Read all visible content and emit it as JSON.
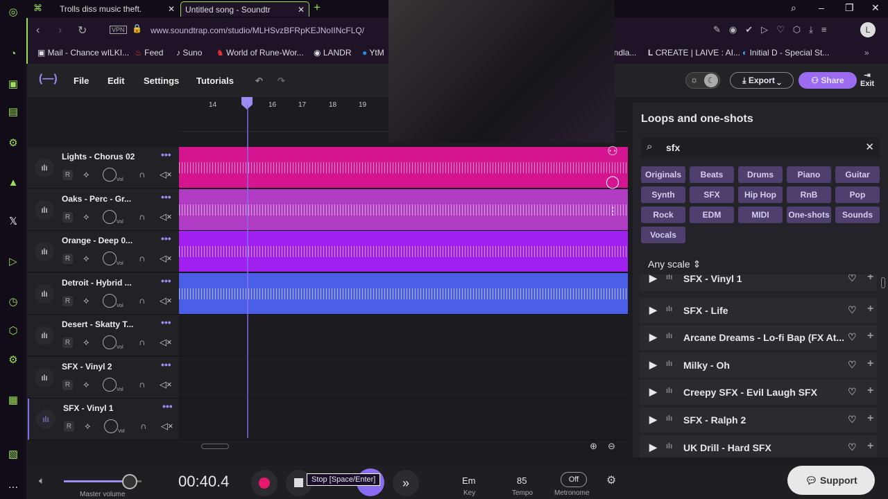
{
  "browser": {
    "tabs": [
      {
        "label": "Trolls diss music theft."
      },
      {
        "label": "Untitled song - Soundtr"
      }
    ],
    "new_tab": "+",
    "url": "www.soundtrap.com/studio/MLHSvzBFRpKEJNoIINcFLQ/",
    "vpn": "VPN",
    "bookmarks": [
      "Mail - Chance wILKI...",
      "Feed",
      "Suno",
      "World of Rune-Wor...",
      "LANDR",
      "YtM",
      "andla...",
      "CREATE | LAIVE : AI...",
      "Initial D - Special St..."
    ]
  },
  "app": {
    "menu": [
      "File",
      "Edit",
      "Settings",
      "Tutorials"
    ],
    "export": "Export",
    "share": "Share",
    "exit": "Exit",
    "ruler": [
      "14",
      "16",
      "17",
      "18",
      "19"
    ],
    "tracks": [
      {
        "name": "Lights - Chorus 02",
        "color": "#d4158f"
      },
      {
        "name": "Oaks - Perc - Gr...",
        "color": "#b13cc4"
      },
      {
        "name": "Orange - Deep 0...",
        "color": "#a020f0"
      },
      {
        "name": "Detroit - Hybrid ...",
        "color": "#4a5ee8"
      },
      {
        "name": "Desert - Skatty T...",
        "color": ""
      },
      {
        "name": "SFX - Vinyl 2",
        "color": ""
      },
      {
        "name": "SFX - Vinyl 1",
        "color": ""
      }
    ],
    "track_controls": {
      "record": "R",
      "vol": "Vol"
    }
  },
  "panel": {
    "title": "Loops and one-shots",
    "search_value": "sfx",
    "chips": [
      "Originals",
      "Beats",
      "Drums",
      "Piano",
      "Guitar",
      "Synth",
      "SFX",
      "Hip Hop",
      "RnB",
      "Pop",
      "Rock",
      "EDM",
      "MIDI",
      "One-shots",
      "Sounds",
      "Vocals"
    ],
    "scale": "Any scale",
    "results": [
      "SFX - Vinyl 1",
      "SFX - Life",
      "Arcane Dreams - Lo-fi Bap (FX At...",
      "Milky - Oh",
      "Creepy SFX - Evil Laugh SFX",
      "SFX - Ralph 2",
      "UK Drill - Hard SFX"
    ]
  },
  "transport": {
    "master_volume_label": "Master volume",
    "master_volume": 0.85,
    "time": "00:40.4",
    "tooltip": "Stop [Space/Enter]",
    "key": "Em",
    "key_label": "Key",
    "tempo": "85",
    "tempo_label": "Tempo",
    "metronome": "Off",
    "metronome_label": "Metronome",
    "support": "Support"
  },
  "colors": {
    "accent": "#8a6cf0",
    "browser_accent": "#9be05a"
  }
}
